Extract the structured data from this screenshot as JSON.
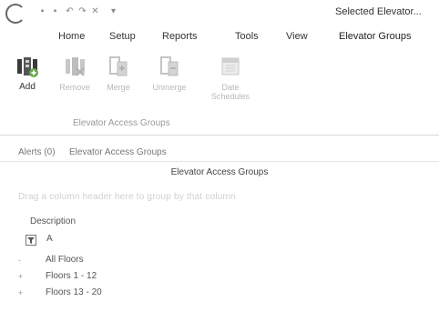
{
  "window": {
    "title": "Selected  Elevator..."
  },
  "tabs": [
    {
      "label": "Home"
    },
    {
      "label": "Setup"
    },
    {
      "label": "Reports"
    },
    {
      "label": "Tools"
    },
    {
      "label": "View"
    },
    {
      "label": "Elevator Groups"
    }
  ],
  "ribbon": {
    "buttons": [
      {
        "label": "Add",
        "enabled": true,
        "icon": "add-group-icon"
      },
      {
        "label": "Remove",
        "enabled": false,
        "icon": "remove-group-icon"
      },
      {
        "label": "Merge",
        "enabled": false,
        "icon": "merge-icon"
      },
      {
        "label": "Unmerge",
        "enabled": false,
        "icon": "unmerge-icon"
      },
      {
        "label": "Date\nSchedules",
        "enabled": false,
        "icon": "calendar-icon"
      }
    ],
    "group_label": "Elevator Access Groups"
  },
  "breadcrumb": {
    "alerts": "Alerts (0)",
    "current": "Elevator Access Groups"
  },
  "main": {
    "title": "Elevator Access Groups",
    "hint": "Drag a column header here to group by that column",
    "column_header": "Description",
    "filter_text": "A",
    "rows": [
      {
        "mark": "-",
        "label": "All Floors"
      },
      {
        "mark": "+",
        "label": "Floors 1 - 12"
      },
      {
        "mark": "+",
        "label": "Floors 13 - 20"
      }
    ]
  },
  "colors": {
    "text": "#333333",
    "disabled": "#b8b8b8",
    "background": "#ffffff"
  }
}
